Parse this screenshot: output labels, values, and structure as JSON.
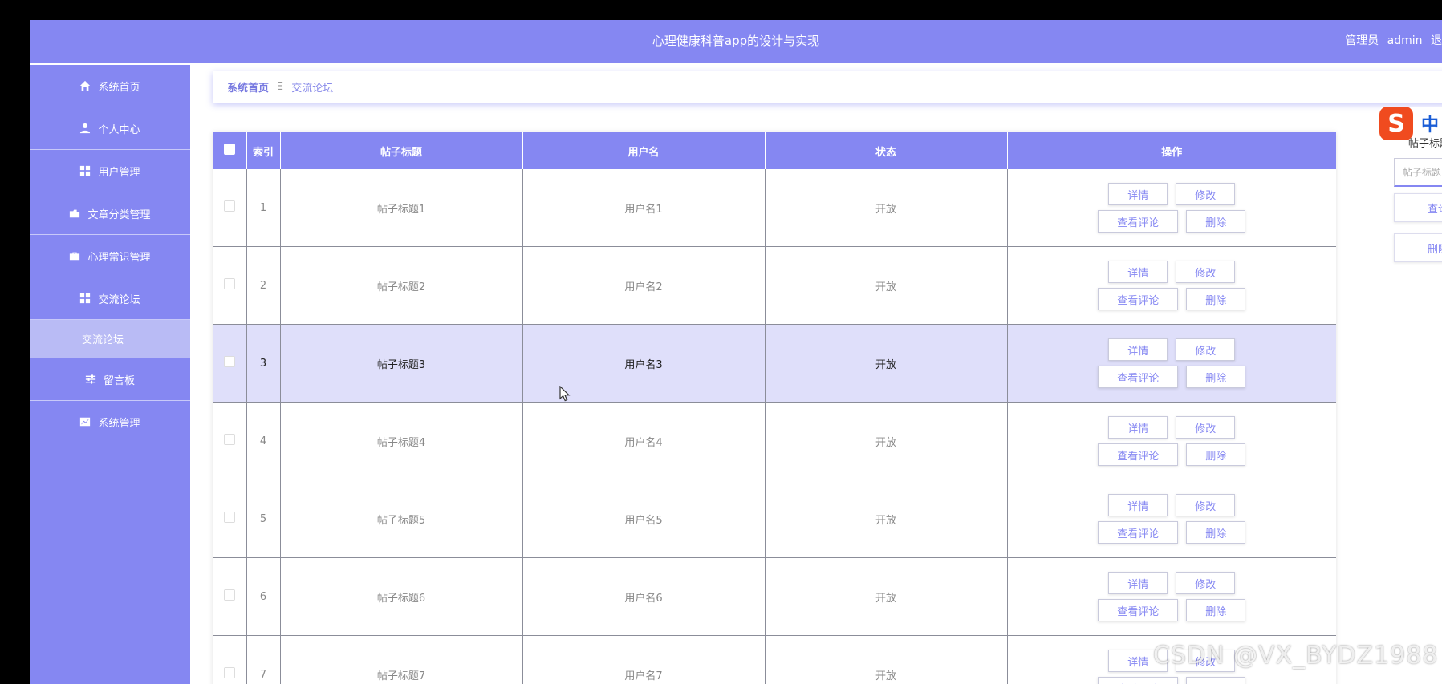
{
  "header": {
    "title": "心理健康科普app的设计与实现",
    "role": "管理员",
    "username": "admin",
    "logout_partial": "退"
  },
  "sidebar": {
    "items": [
      {
        "label": "系统首页",
        "icon": "home-icon"
      },
      {
        "label": "个人中心",
        "icon": "user-icon"
      },
      {
        "label": "用户管理",
        "icon": "grid-icon"
      },
      {
        "label": "文章分类管理",
        "icon": "folder-icon"
      },
      {
        "label": "心理常识管理",
        "icon": "briefcase-icon"
      },
      {
        "label": "交流论坛",
        "icon": "grid-icon"
      }
    ],
    "sub_item": "交流论坛",
    "items_after": [
      {
        "label": "留言板",
        "icon": "sliders-icon"
      },
      {
        "label": "系统管理",
        "icon": "chart-icon"
      }
    ]
  },
  "breadcrumb": {
    "home": "系统首页",
    "separator": "Ξ",
    "current": "交流论坛"
  },
  "table": {
    "headers": [
      "索引",
      "帖子标题",
      "用户名",
      "状态",
      "操作"
    ],
    "buttons": {
      "detail": "详情",
      "edit": "修改",
      "comments": "查看评论",
      "delete": "删除"
    },
    "rows": [
      {
        "index": "1",
        "title": "帖子标题1",
        "user": "用户名1",
        "status": "开放"
      },
      {
        "index": "2",
        "title": "帖子标题2",
        "user": "用户名2",
        "status": "开放"
      },
      {
        "index": "3",
        "title": "帖子标题3",
        "user": "用户名3",
        "status": "开放"
      },
      {
        "index": "4",
        "title": "帖子标题4",
        "user": "用户名4",
        "status": "开放"
      },
      {
        "index": "5",
        "title": "帖子标题5",
        "user": "用户名5",
        "status": "开放"
      },
      {
        "index": "6",
        "title": "帖子标题6",
        "user": "用户名6",
        "status": "开放"
      },
      {
        "index": "7",
        "title": "帖子标题7",
        "user": "用户名7",
        "status": "开放"
      }
    ]
  },
  "search": {
    "label": "帖子标题",
    "placeholder": "帖子标题",
    "query_button": "查询",
    "delete_button": "删除"
  },
  "ime": {
    "mode": "中",
    "punct": "°,"
  },
  "watermark": "CSDN @VX_BYDZ1988",
  "colors": {
    "accent": "#8587f2",
    "row_hover": "#dfdffa"
  }
}
